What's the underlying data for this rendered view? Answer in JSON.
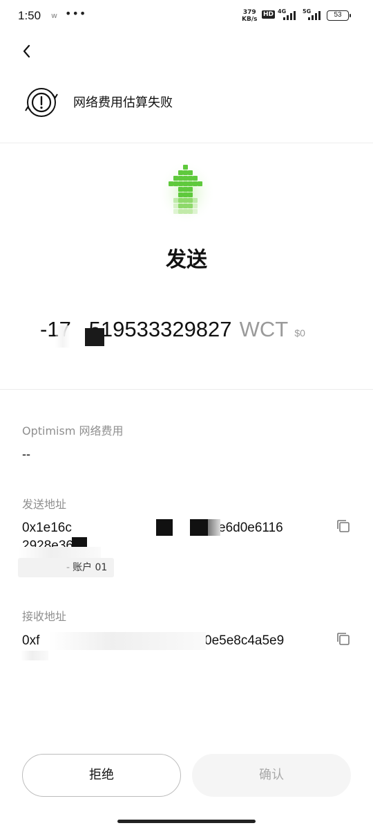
{
  "status_bar": {
    "time": "1:50",
    "app_glyph": "w",
    "more": "•••",
    "speed_value": "379",
    "speed_unit": "KB/s",
    "hd": "HD",
    "net_1": "4G",
    "net_2": "5G",
    "battery": "53"
  },
  "header": {
    "back_icon": "chevron-left-icon",
    "warning_icon": "alert-circle-refresh-icon",
    "warning_text": "网络费用估算失败"
  },
  "hero": {
    "icon": "pixel-up-arrow-icon",
    "icon_color": "#5fc93d",
    "title": "发送",
    "amount": "-17   519533329827",
    "unit": "WCT",
    "usd": "$0"
  },
  "fee": {
    "label": "Optimism 网络费用",
    "value": "--"
  },
  "from": {
    "label": "发送地址",
    "addr_line1_start": "0x1e16c",
    "addr_line1_end": "e6d0e6116",
    "addr_line2": "2928e36",
    "account": "账户 01",
    "copy_icon": "copy-icon"
  },
  "to": {
    "label": "接收地址",
    "addr_line1_start": "0xf",
    "addr_line1_end": "0e5e8c4a5e9",
    "copy_icon": "copy-icon"
  },
  "actions": {
    "reject": "拒绝",
    "confirm": "确认"
  }
}
